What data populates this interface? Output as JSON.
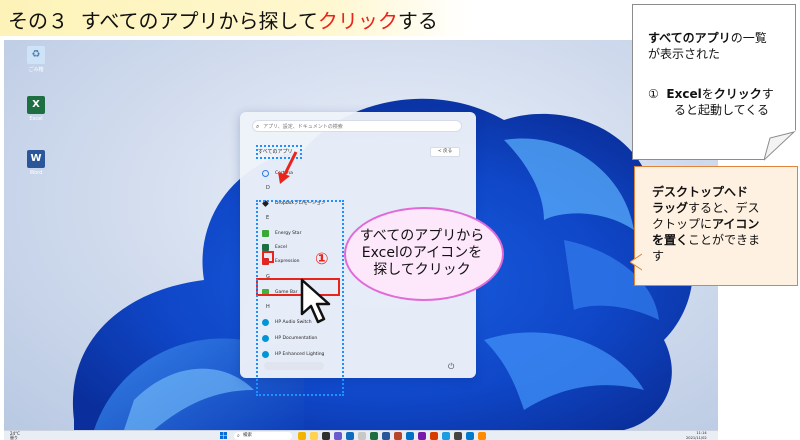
{
  "header": {
    "prefix": "その３",
    "text_before": "すべてのアプリから探して",
    "text_accent": "クリック",
    "text_after": "する"
  },
  "desktop": {
    "icons": [
      {
        "label": "ごみ箱",
        "icon": "recycle-bin-icon"
      },
      {
        "label": "Excel",
        "icon": "excel-icon"
      },
      {
        "label": "Word",
        "icon": "word-icon"
      }
    ]
  },
  "start_menu": {
    "search_placeholder": "アプリ、設定、ドキュメントの検索",
    "all_apps_label": "すべてのアプリ",
    "back_label": "< 戻る",
    "letters": {
      "d": "D",
      "e": "E",
      "g": "G",
      "h": "H"
    },
    "apps": {
      "cortana": "Cortana",
      "dropbox": "Dropboxプロモーション",
      "energy_star": "Energy Star",
      "excel": "Excel",
      "expression": "Expression",
      "game_bar": "Game Bar",
      "hp_audio": "HP Audio Switch",
      "hp_doc": "HP Documentation",
      "hp_light": "HP Enhanced Lighting"
    }
  },
  "callout": {
    "number": "①",
    "line1": "すべてのアプリから",
    "line2": "Excelのアイコンを",
    "line3": "探してクリック"
  },
  "taskbar": {
    "weather_temp": "24°C",
    "weather_desc": "曇り",
    "search_label": "検索",
    "time": "11:14",
    "date": "2021/11/02"
  },
  "note1": {
    "line1_bold": "すべてのアプリ",
    "line1_rest": "の一覧",
    "line2": "が表示された",
    "item_num": "①",
    "item_bold1": "Excel",
    "item_text1": "を",
    "item_bold2": "クリック",
    "item_text2": "す",
    "item_line2": "ると起動してくる"
  },
  "note2": {
    "bold1": "デスクトップへド",
    "bold2": "ラッグ",
    "text1": "すると、デス",
    "text2": "クトップに",
    "bold3": "アイコン",
    "bold4": "を置く",
    "text3": "ことができま",
    "text4": "す"
  },
  "colors": {
    "accent_red": "#e8241c",
    "callout_border": "#e06ad8",
    "callout_fill": "#fde7fb",
    "note2_border": "#e2833a",
    "note2_fill": "#fff1e2",
    "highlight_blue": "#1e90ff"
  }
}
